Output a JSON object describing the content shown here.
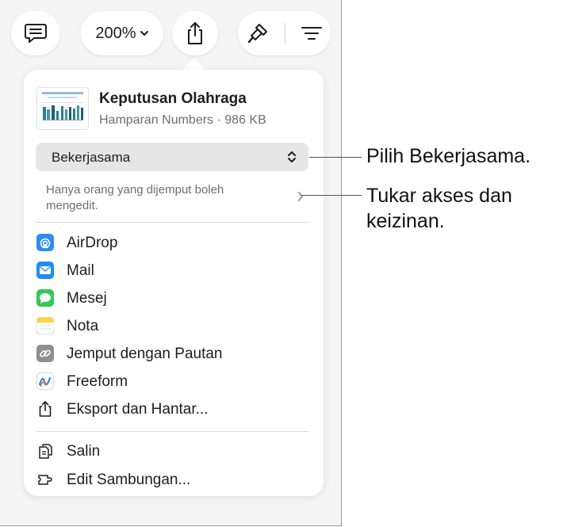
{
  "toolbar": {
    "zoom_label": "200%"
  },
  "document": {
    "title": "Keputusan Olahraga",
    "subtitle": "Hamparan Numbers · 986 KB"
  },
  "collaboration": {
    "selected": "Bekerjasama",
    "access_text": "Hanya orang yang dijemput boleh mengedit."
  },
  "menu": {
    "items": [
      {
        "label": "AirDrop",
        "icon": "airdrop-icon",
        "color": "#2f8cf5"
      },
      {
        "label": "Mail",
        "icon": "mail-icon",
        "color": "#1e8cf5"
      },
      {
        "label": "Mesej",
        "icon": "messages-icon",
        "color": "#34c759"
      },
      {
        "label": "Nota",
        "icon": "notes-icon",
        "color": "#ffd33d"
      },
      {
        "label": "Jemput dengan Pautan",
        "icon": "link-icon",
        "color": "#8e8e93"
      },
      {
        "label": "Freeform",
        "icon": "freeform-icon",
        "color": "#ffffff"
      },
      {
        "label": "Eksport dan Hantar...",
        "icon": "export-icon",
        "color": "#1d1d1f"
      }
    ],
    "secondary": [
      {
        "label": "Salin",
        "icon": "copy-icon"
      },
      {
        "label": "Edit Sambungan...",
        "icon": "extensions-icon"
      }
    ]
  },
  "callouts": {
    "choose_collab": "Pilih Bekerjasama.",
    "change_access": "Tukar akses dan keizinan."
  }
}
